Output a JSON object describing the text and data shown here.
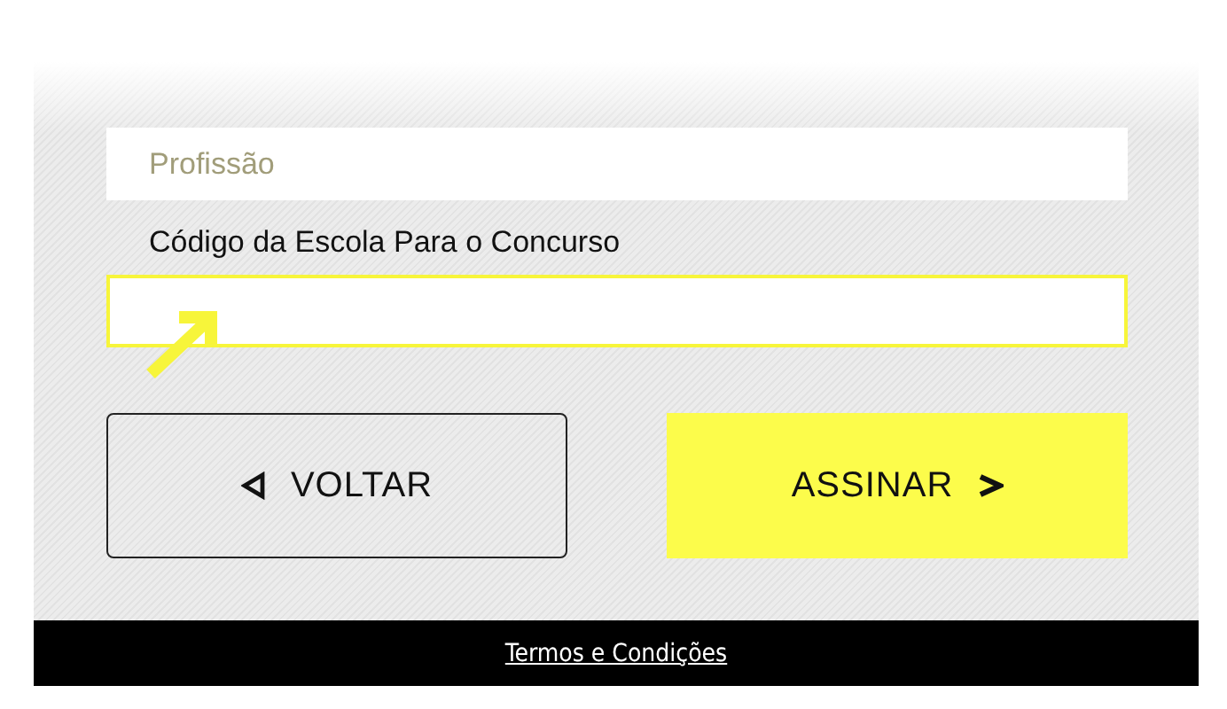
{
  "form": {
    "fields": [
      {
        "kind": "placeholder",
        "placeholder": "Profissão"
      },
      {
        "kind": "labeled",
        "label": "Código da Escola Para o Concurso",
        "focused": true
      }
    ]
  },
  "buttons": [
    {
      "label": "VOLTAR",
      "kind": "back"
    },
    {
      "label": "ASSINAR",
      "kind": "submit"
    }
  ],
  "footer": {
    "link": "Termos e Condições"
  }
}
